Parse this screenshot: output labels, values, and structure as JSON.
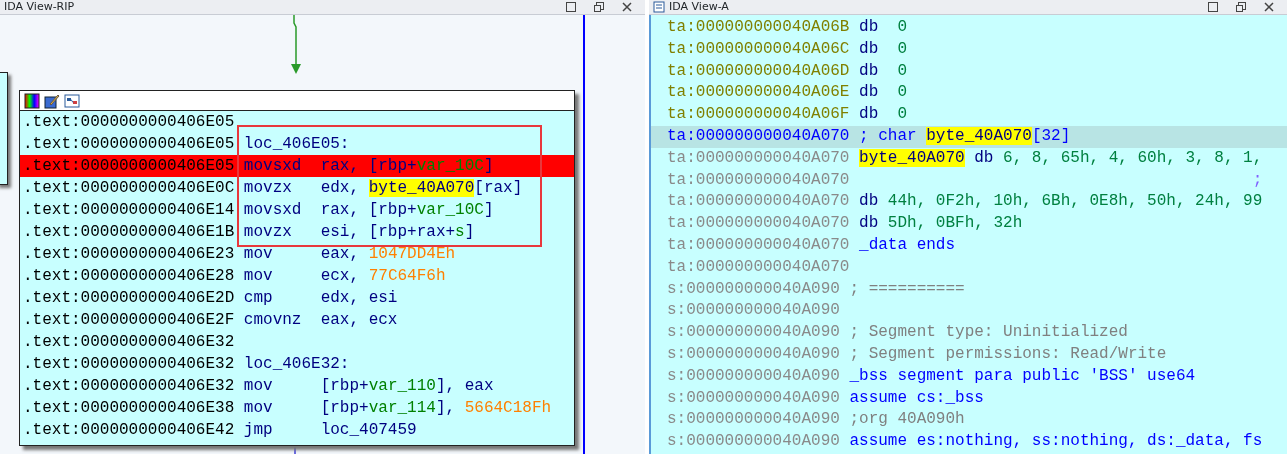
{
  "left_view": {
    "title": "IDA View-RIP",
    "node": {
      "lines": [
        {
          "addr": ".text:0000000000406E05",
          "selected": false
        },
        {
          "addr": ".text:0000000000406E05",
          "label": "loc_406E05:",
          "selected": false
        },
        {
          "addr": ".text:0000000000406E05",
          "mnemonic": "movsxd",
          "operands": [
            {
              "text": "rax, [rbp+",
              "kind": "plain"
            },
            {
              "text": "var_10C",
              "kind": "var"
            },
            {
              "text": "]",
              "kind": "plain"
            }
          ],
          "selected": true
        },
        {
          "addr": ".text:0000000000406E0C",
          "mnemonic": "movzx",
          "operands": [
            {
              "text": "edx, ",
              "kind": "plain"
            },
            {
              "text": "byte_40A070",
              "kind": "hl"
            },
            {
              "text": "[rax]",
              "kind": "plain"
            }
          ],
          "selected": false
        },
        {
          "addr": ".text:0000000000406E14",
          "mnemonic": "movsxd",
          "operands": [
            {
              "text": "rax, [rbp+",
              "kind": "plain"
            },
            {
              "text": "var_10C",
              "kind": "var"
            },
            {
              "text": "]",
              "kind": "plain"
            }
          ],
          "selected": false
        },
        {
          "addr": ".text:0000000000406E1B",
          "mnemonic": "movzx",
          "operands": [
            {
              "text": "esi, [rbp+rax+",
              "kind": "plain"
            },
            {
              "text": "s",
              "kind": "var"
            },
            {
              "text": "]",
              "kind": "plain"
            }
          ],
          "selected": false
        },
        {
          "addr": ".text:0000000000406E23",
          "mnemonic": "mov",
          "operands": [
            {
              "text": "eax, ",
              "kind": "plain"
            },
            {
              "text": "1047DD4Eh",
              "kind": "num"
            }
          ],
          "selected": false
        },
        {
          "addr": ".text:0000000000406E28",
          "mnemonic": "mov",
          "operands": [
            {
              "text": "ecx, ",
              "kind": "plain"
            },
            {
              "text": "77C64F6h",
              "kind": "num"
            }
          ],
          "selected": false
        },
        {
          "addr": ".text:0000000000406E2D",
          "mnemonic": "cmp",
          "operands": [
            {
              "text": "edx, esi",
              "kind": "plain"
            }
          ],
          "selected": false
        },
        {
          "addr": ".text:0000000000406E2F",
          "mnemonic": "cmovnz",
          "operands": [
            {
              "text": "eax, ecx",
              "kind": "plain"
            }
          ],
          "selected": false
        },
        {
          "addr": ".text:0000000000406E32",
          "selected": false
        },
        {
          "addr": ".text:0000000000406E32",
          "label": "loc_406E32:",
          "selected": false
        },
        {
          "addr": ".text:0000000000406E32",
          "mnemonic": "mov",
          "operands": [
            {
              "text": "[rbp+",
              "kind": "plain"
            },
            {
              "text": "var_110",
              "kind": "var"
            },
            {
              "text": "], eax",
              "kind": "plain"
            }
          ],
          "selected": false
        },
        {
          "addr": ".text:0000000000406E38",
          "mnemonic": "mov",
          "operands": [
            {
              "text": "[rbp+",
              "kind": "plain"
            },
            {
              "text": "var_114",
              "kind": "var"
            },
            {
              "text": "], ",
              "kind": "plain"
            },
            {
              "text": "5664C18Fh",
              "kind": "num"
            }
          ],
          "selected": false
        },
        {
          "addr": ".text:0000000000406E42",
          "mnemonic": "jmp",
          "operands": [
            {
              "text": "loc_407459",
              "kind": "plain"
            }
          ],
          "selected": false
        }
      ]
    }
  },
  "right_view": {
    "title": "IDA View-A",
    "lines": [
      {
        "addr": "ta:000000000040A06B",
        "kind": "data",
        "parts": [
          {
            "text": "db",
            "kind": "opcode"
          },
          {
            "text": "0",
            "kind": "num"
          }
        ],
        "selected": false
      },
      {
        "addr": "ta:000000000040A06C",
        "kind": "data",
        "parts": [
          {
            "text": "db",
            "kind": "opcode"
          },
          {
            "text": "0",
            "kind": "num"
          }
        ],
        "selected": false
      },
      {
        "addr": "ta:000000000040A06D",
        "kind": "data",
        "parts": [
          {
            "text": "db",
            "kind": "opcode"
          },
          {
            "text": "0",
            "kind": "num"
          }
        ],
        "selected": false
      },
      {
        "addr": "ta:000000000040A06E",
        "kind": "data",
        "parts": [
          {
            "text": "db",
            "kind": "opcode"
          },
          {
            "text": "0",
            "kind": "num"
          }
        ],
        "selected": false
      },
      {
        "addr": "ta:000000000040A06F",
        "kind": "data",
        "parts": [
          {
            "text": "db",
            "kind": "opcode"
          },
          {
            "text": "0",
            "kind": "num"
          }
        ],
        "selected": false
      },
      {
        "addr": "ta:000000000040A070",
        "kind": "current",
        "parts": [
          {
            "text": "; char ",
            "kind": "keyword"
          },
          {
            "text": "byte_40A070",
            "kind": "hl"
          },
          {
            "text": "[32]",
            "kind": "keyword"
          }
        ],
        "selected": true
      },
      {
        "addr": "ta:000000000040A070",
        "kind": "dim",
        "parts": [
          {
            "text": "byte_40A070",
            "kind": "hl"
          },
          {
            "text": " db ",
            "kind": "plain"
          },
          {
            "text": "6, 8, 65h, 4, 60h, 3, 8, 1,",
            "kind": "num"
          }
        ],
        "selected": false
      },
      {
        "addr": "ta:000000000040A070",
        "kind": "dim",
        "parts": [
          {
            "text": ";",
            "kind": "far_comment"
          }
        ],
        "selected": false
      },
      {
        "addr": "ta:000000000040A070",
        "kind": "dim",
        "parts": [
          {
            "text": "db ",
            "kind": "plain"
          },
          {
            "text": "44h, 0F2h, 10h, 6Bh, 0E8h, 50h, 24h, 99",
            "kind": "num"
          }
        ],
        "selected": false
      },
      {
        "addr": "ta:000000000040A070",
        "kind": "dim",
        "parts": [
          {
            "text": "db ",
            "kind": "plain"
          },
          {
            "text": "5Dh, 0BFh, 32h",
            "kind": "num"
          }
        ],
        "selected": false
      },
      {
        "addr": "ta:000000000040A070",
        "kind": "dim",
        "parts": [
          {
            "text": "_data ends",
            "kind": "keyword"
          }
        ],
        "selected": false
      },
      {
        "addr": "ta:000000000040A070",
        "kind": "dim",
        "selected": false
      },
      {
        "addr": "s:000000000040A090",
        "kind": "dim",
        "parts": [
          {
            "text": "; ==========",
            "kind": "comment"
          }
        ],
        "selected": false
      },
      {
        "addr": "s:000000000040A090",
        "kind": "dim",
        "selected": false
      },
      {
        "addr": "s:000000000040A090",
        "kind": "dim",
        "parts": [
          {
            "text": "; Segment type: Uninitialized",
            "kind": "comment"
          }
        ],
        "selected": false
      },
      {
        "addr": "s:000000000040A090",
        "kind": "dim",
        "parts": [
          {
            "text": "; Segment permissions: Read/Write",
            "kind": "comment"
          }
        ],
        "selected": false
      },
      {
        "addr": "s:000000000040A090",
        "kind": "dim",
        "parts": [
          {
            "text": "_bss segment para public 'BSS' use64",
            "kind": "keyword"
          }
        ],
        "selected": false
      },
      {
        "addr": "s:000000000040A090",
        "kind": "dim",
        "parts": [
          {
            "text": "assume cs:_bss",
            "kind": "keyword"
          }
        ],
        "selected": false
      },
      {
        "addr": "s:000000000040A090",
        "kind": "dim",
        "parts": [
          {
            "text": ";org 40A090h",
            "kind": "comment"
          }
        ],
        "selected": false
      },
      {
        "addr": "s:000000000040A090",
        "kind": "dim",
        "parts": [
          {
            "text": "assume es:nothing, ss:nothing, ds:_data, fs",
            "kind": "keyword"
          }
        ],
        "selected": false
      }
    ]
  }
}
